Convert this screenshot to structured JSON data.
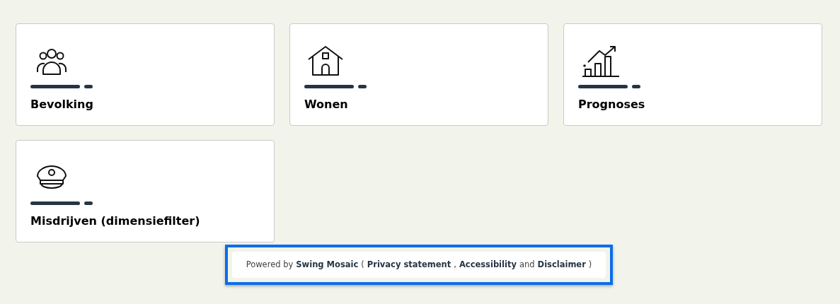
{
  "tiles": [
    {
      "kind": "people",
      "title": "Bevolking"
    },
    {
      "kind": "house",
      "title": "Wonen"
    },
    {
      "kind": "chart",
      "title": "Prognoses"
    },
    {
      "kind": "cap",
      "title": "Misdrijven (dimensiefilter)"
    }
  ],
  "footer": {
    "focused": true,
    "parts": [
      {
        "kind": "text",
        "text": "Powered by"
      },
      {
        "kind": "brand",
        "text": "Swing Mosaic"
      },
      {
        "kind": "text",
        "text": "("
      },
      {
        "kind": "link",
        "text": "Privacy statement"
      },
      {
        "kind": "text",
        "text": ","
      },
      {
        "kind": "link",
        "text": "Accessibility"
      },
      {
        "kind": "text",
        "text": "and"
      },
      {
        "kind": "link",
        "text": "Disclaimer"
      },
      {
        "kind": "text",
        "text": ")"
      }
    ]
  }
}
